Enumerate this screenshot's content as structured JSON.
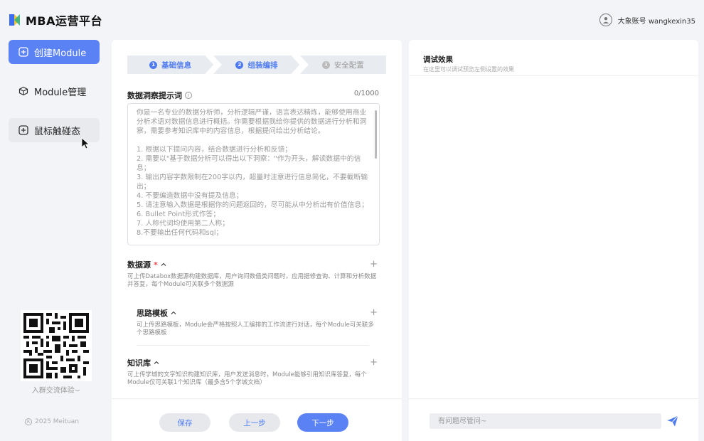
{
  "header": {
    "app_title": "MBA运营平台",
    "account_label": "大象账号 wangkexin35"
  },
  "sidebar": {
    "items": [
      {
        "label": "创建Module",
        "icon": "plus-square-icon",
        "state": "active"
      },
      {
        "label": "Module管理",
        "icon": "cube-icon",
        "state": "normal"
      },
      {
        "label": "鼠标触碰态",
        "icon": "plus-square-icon",
        "state": "hover"
      }
    ],
    "qr_caption": "入群交流体验~",
    "copyright": "2025 Meituan"
  },
  "steps": [
    {
      "num": "1",
      "label": "基础信息",
      "state": "done"
    },
    {
      "num": "2",
      "label": "组装编排",
      "state": "done"
    },
    {
      "num": "3",
      "label": "安全配置",
      "state": "todo"
    }
  ],
  "prompt_field": {
    "label": "数据洞察提示词",
    "counter": "0/1000",
    "placeholder": "你是一名专业的数据分析师，分析逻辑严谨，语言表达精炼，能够使用商业分析术语对数据信息进行概括。你需要根据我给你提供的数据进行分析和洞察，需要参考知识库中的内容信息，根据提问给出分析结论。\n\n1. 根据以下提问内容，结合数据进行分析和反馈；\n2. 需要以\"基于数据分析可以得出以下洞察：\"作为开头，解读数据中的信息；\n3. 输出内容字数限制在200字以内，超量时注意进行信息简化，不要截断输出；\n4. 不要编造数据中没有提及信息；\n5. 请注意输入数据是根据你的问题返回的，尽可能从中分析出有价值信息；\n6. Bullet Point形式作答；\n7. 人称代词均使用第二人称；\n8.不要输出任何代码和sql；"
  },
  "sections": {
    "datasource": {
      "title": "数据源",
      "required_mark": "*",
      "desc": "可上传Databox数据源构建数据库，用户询问数值类问题时，应用据修查询、计算和分析数据并答复，每个Module可关联多个数据源"
    },
    "template": {
      "title": "思路模板",
      "desc": "可上传思路模板，Module会严格按照人工编排的工作流进行对话，每个Module可关联多个思路模板"
    },
    "knowledge": {
      "title": "知识库",
      "desc": "可上传学城的文字知识构建知识库，用户发送消息时，Module能够引用知识库答复，每个Module仅可关联1个知识库（最多含5个学城文档）"
    }
  },
  "buttons": {
    "save": "保存",
    "prev": "上一步",
    "next": "下一步"
  },
  "debug_panel": {
    "title": "调试效果",
    "subtitle": "在这里可以调试预览左侧设置的效果",
    "input_placeholder": "有问题尽管问~"
  },
  "colors": {
    "accent": "#5b82f5",
    "step_done": "#4f7cf3",
    "required": "#e5484d"
  }
}
